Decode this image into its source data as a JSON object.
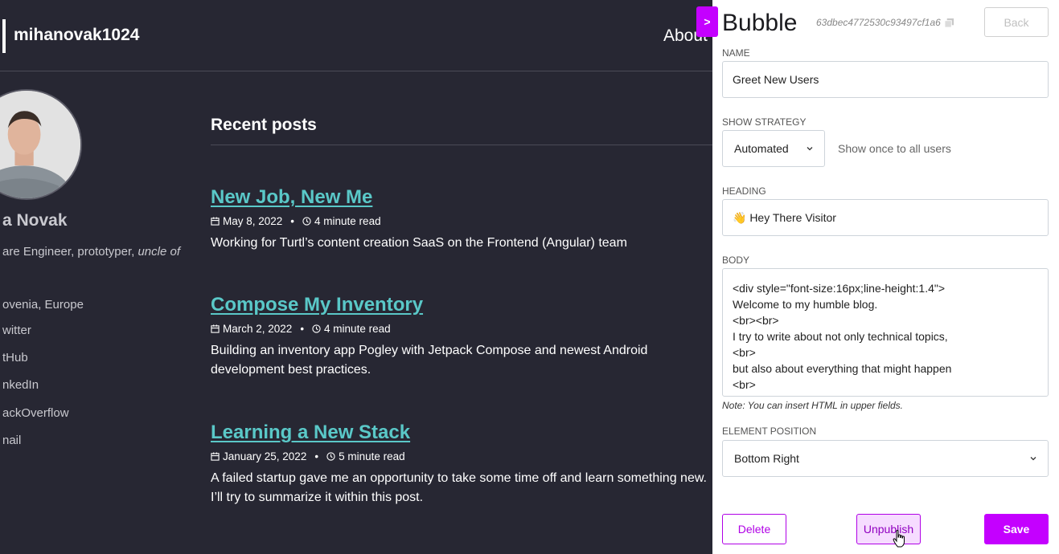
{
  "blog": {
    "brand": "mihanovak1024",
    "nav_about": "About",
    "author_name": "a Novak",
    "author_bio_plain": "are Engineer, prototyper, ",
    "author_bio_italic": "uncle of",
    "social": [
      "ovenia, Europe",
      "witter",
      "tHub",
      "nkedIn",
      "ackOverflow",
      "nail"
    ],
    "section_title": "Recent posts",
    "posts": [
      {
        "title": "New Job, New Me",
        "date": "May 8, 2022",
        "read": "4 minute read",
        "desc": "Working for Turtl’s content creation SaaS on the Frontend (Angular) team"
      },
      {
        "title": "Compose My Inventory",
        "date": "March 2, 2022",
        "read": "4 minute read",
        "desc": "Building an inventory app Pogley with Jetpack Compose and newest Android development best practices."
      },
      {
        "title": "Learning a New Stack",
        "date": "January 25, 2022",
        "read": "5 minute read",
        "desc": "A failed startup gave me an opportunity to take some time off and learn something new. I’ll try to summarize it within this post."
      }
    ],
    "meta_separator": "•"
  },
  "toggle": {
    "label": ">"
  },
  "panel": {
    "title": "Bubble",
    "id": "63dbec4772530c93497cf1a6",
    "back_label": "Back",
    "name_label": "NAME",
    "name_value": "Greet New Users",
    "strategy_label": "SHOW STRATEGY",
    "strategy_value": "Automated",
    "strategy_desc": "Show once to all users",
    "heading_label": "HEADING",
    "heading_value": "👋 Hey There Visitor",
    "body_label": "BODY",
    "body_lines": [
      "<div style=\"font-size:16px;line-height:1.4\">",
      "Welcome to my humble blog.",
      "<br><br>",
      "I try to write about not only technical topics,",
      "<br>",
      "but also about everything that might happen",
      "<br>"
    ],
    "note": "Note: You can insert HTML in upper fields.",
    "position_label": "ELEMENT POSITION",
    "position_value": "Bottom Right",
    "delete_label": "Delete",
    "unpublish_label": "Unpublish",
    "save_label": "Save"
  },
  "icons": {
    "calendar": "calendar-icon",
    "clock": "clock-icon",
    "copy": "copy-icon",
    "chevron": "chevron-down-icon",
    "cursor": "hand-pointer-icon"
  },
  "colors": {
    "accent": "#c400ff",
    "link": "#5ac8c8",
    "blog_bg": "#272733"
  }
}
